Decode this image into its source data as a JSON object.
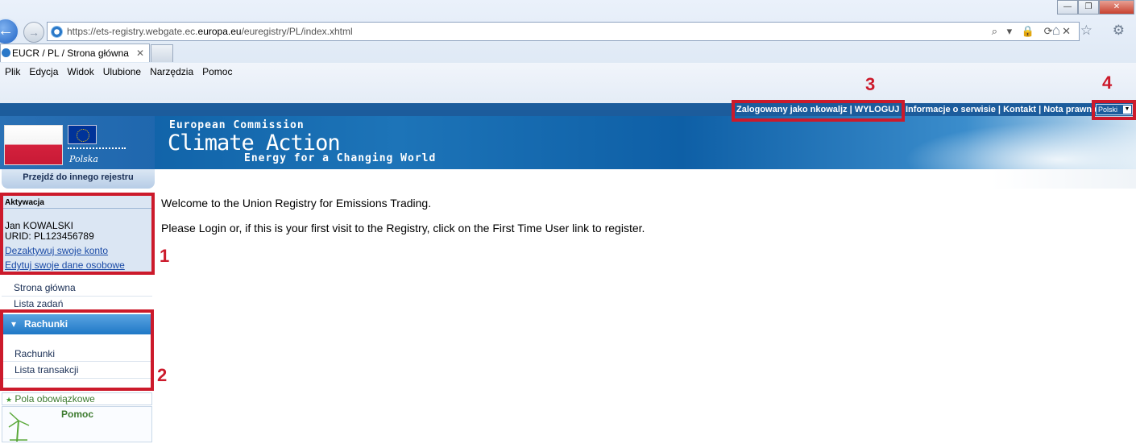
{
  "browser": {
    "url_prefix": "https://ets-registry.webgate.ec.",
    "url_domain": "europa.eu",
    "url_suffix": "/euregistry/PL/index.xhtml",
    "tab_title": "EUCR / PL / Strona główna",
    "tab_close": "✕",
    "back_arrow": "←",
    "forward_arrow": "→",
    "address_tools": "⌕ ▾ 🔒 ⟳ ✕",
    "right_icons": "⌂ ☆ ⚙",
    "window_buttons": [
      "—",
      "❐",
      "✕"
    ],
    "menu": [
      "Plik",
      "Edycja",
      "Widok",
      "Ulubione",
      "Narzędzia",
      "Pomoc"
    ]
  },
  "header": {
    "logged_in": "Zalogowany jako nkowaljz  | WYLOGUJ",
    "links": "Informacje o serwisie | Kontakt | Nota prawna",
    "language": "Polski",
    "language_arrow": "▼"
  },
  "banner": {
    "line1": "European Commission",
    "line2": "Climate Action",
    "line3": "Energy for a Changing World",
    "country": "Polska"
  },
  "sidebar": {
    "switch_registry": "Przejdź do innego rejestru",
    "activation": {
      "title": "Aktywacja",
      "name": "Jan KOWALSKI",
      "urid": "URID: PL123456789",
      "deactivate": "Dezaktywuj swoje konto",
      "edit": "Edytuj swoje dane osobowe"
    },
    "nav": [
      "Strona główna",
      "Lista zadań"
    ],
    "accounts": {
      "header_arrow": "▾",
      "header": "Rachunki",
      "items": [
        "Rachunki",
        "Lista transakcji"
      ]
    },
    "required_star": "★",
    "required": "Pola obowiązkowe",
    "help": "Pomoc"
  },
  "main": {
    "welcome": "Welcome to the Union Registry for Emissions Trading.",
    "instructions": "Please Login or, if this is your first visit to the Registry, click on the First Time User link to register."
  },
  "annotations": {
    "colors": {
      "highlight": "#cc1a2b"
    },
    "labels": [
      "1",
      "2",
      "3",
      "4"
    ]
  }
}
